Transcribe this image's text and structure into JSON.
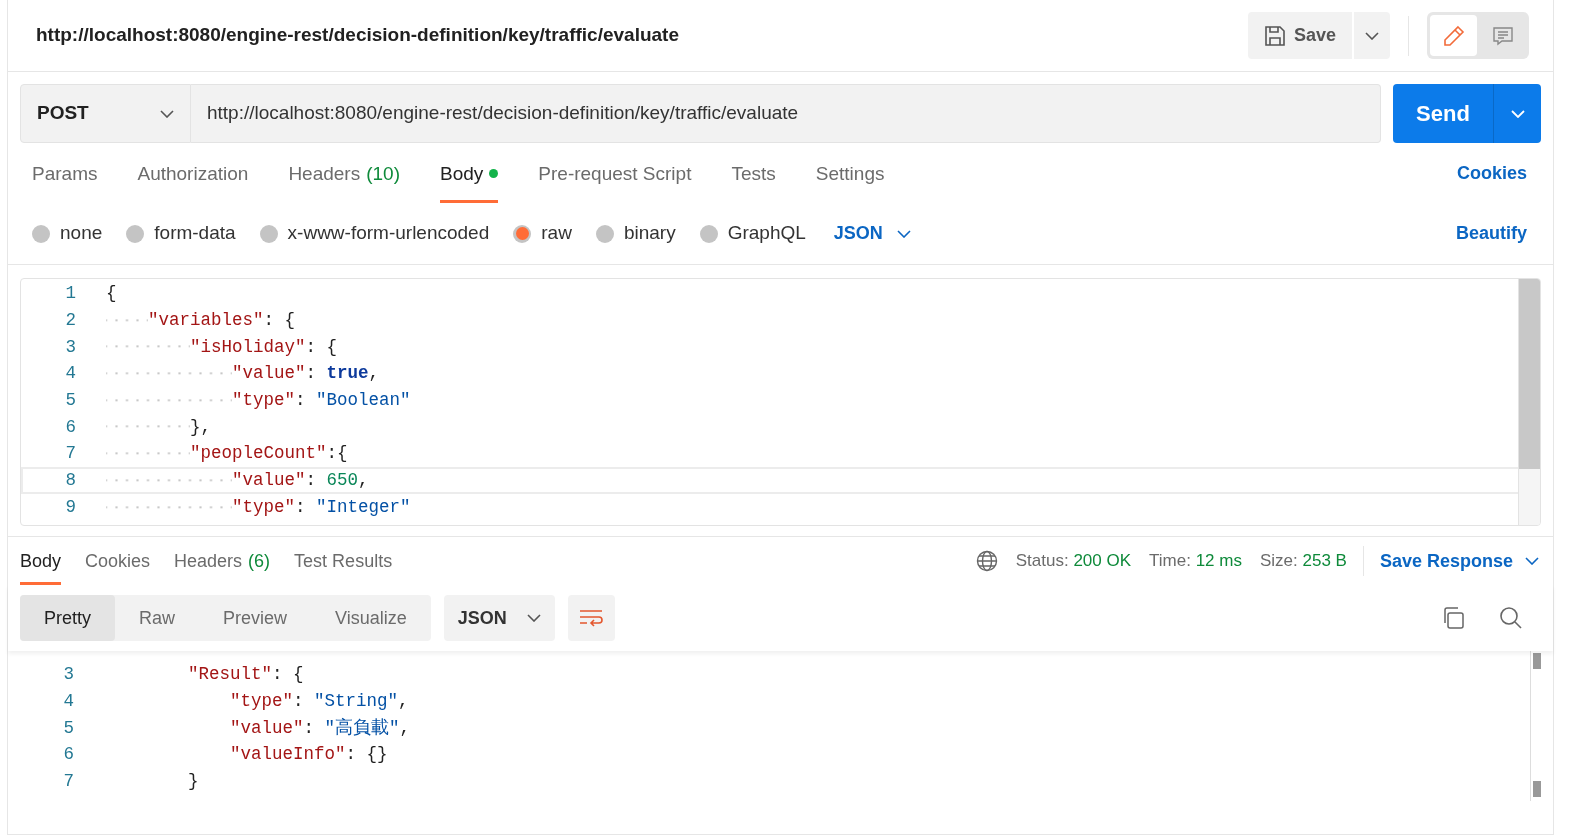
{
  "header": {
    "title": "http://localhost:8080/engine-rest/decision-definition/key/traffic/evaluate",
    "save_label": "Save",
    "modes": [
      {
        "kind": "edit",
        "selected": true
      },
      {
        "kind": "comment",
        "selected": false
      }
    ]
  },
  "request": {
    "method": "POST",
    "url": "http://localhost:8080/engine-rest/decision-definition/key/traffic/evaluate",
    "send_label": "Send"
  },
  "request_tabs": [
    {
      "label": "Params",
      "selected": false
    },
    {
      "label": "Authorization",
      "selected": false
    },
    {
      "label": "Headers",
      "count": "(10)",
      "selected": false
    },
    {
      "label": "Body",
      "dot": true,
      "selected": true
    },
    {
      "label": "Pre-request Script",
      "selected": false
    },
    {
      "label": "Tests",
      "selected": false
    },
    {
      "label": "Settings",
      "selected": false
    }
  ],
  "cookies_link": "Cookies",
  "body_types": [
    {
      "label": "none",
      "selected": false
    },
    {
      "label": "form-data",
      "selected": false
    },
    {
      "label": "x-www-form-urlencoded",
      "selected": false
    },
    {
      "label": "raw",
      "selected": true
    },
    {
      "label": "binary",
      "selected": false
    },
    {
      "label": "GraphQL",
      "selected": false
    }
  ],
  "format": "JSON",
  "beautify_link": "Beautify",
  "request_body": [
    {
      "number": "1",
      "current": false,
      "tokens": [
        {
          "kind": "punct",
          "text": "{"
        }
      ],
      "children": [
        {
          "number": "2",
          "current": false,
          "tokens": [
            {
              "kind": "key",
              "text": "\"variables\""
            },
            {
              "kind": "punct",
              "text": ": {"
            }
          ],
          "children": [
            {
              "number": "3",
              "current": false,
              "tokens": [
                {
                  "kind": "key",
                  "text": "\"isHoliday\""
                },
                {
                  "kind": "punct",
                  "text": ": {"
                }
              ],
              "children": [
                {
                  "number": "4",
                  "current": false,
                  "tokens": [
                    {
                      "kind": "key",
                      "text": "\"value\""
                    },
                    {
                      "kind": "punct",
                      "text": ": "
                    },
                    {
                      "kind": "bool",
                      "text": "true"
                    },
                    {
                      "kind": "punct",
                      "text": ","
                    }
                  ]
                },
                {
                  "number": "5",
                  "current": false,
                  "tokens": [
                    {
                      "kind": "key",
                      "text": "\"type\""
                    },
                    {
                      "kind": "punct",
                      "text": ": "
                    },
                    {
                      "kind": "string",
                      "text": "\"Boolean\""
                    }
                  ]
                }
              ]
            },
            {
              "number": "6",
              "current": false,
              "tokens": [
                {
                  "kind": "punct",
                  "text": "},"
                }
              ]
            },
            {
              "number": "7",
              "current": false,
              "tokens": [
                {
                  "kind": "key",
                  "text": "\"peopleCount\""
                },
                {
                  "kind": "punct",
                  "text": ":{"
                }
              ],
              "children": [
                {
                  "number": "8",
                  "current": true,
                  "tokens": [
                    {
                      "kind": "key",
                      "text": "\"value\""
                    },
                    {
                      "kind": "punct",
                      "text": ": "
                    },
                    {
                      "kind": "number",
                      "text": "650"
                    },
                    {
                      "kind": "punct",
                      "text": ","
                    }
                  ]
                },
                {
                  "number": "9",
                  "current": false,
                  "tokens": [
                    {
                      "kind": "key",
                      "text": "\"type\""
                    },
                    {
                      "kind": "punct",
                      "text": ": "
                    },
                    {
                      "kind": "string",
                      "text": "\"Integer\""
                    }
                  ]
                }
              ]
            }
          ]
        }
      ]
    }
  ],
  "response_tabs": [
    {
      "label": "Body",
      "selected": true
    },
    {
      "label": "Cookies",
      "selected": false
    },
    {
      "label": "Headers",
      "count": "(6)",
      "selected": false
    },
    {
      "label": "Test Results",
      "selected": false
    }
  ],
  "response_meta": [
    {
      "label": "Status:",
      "value": "200 OK"
    },
    {
      "label": "Time:",
      "value": "12 ms"
    },
    {
      "label": "Size:",
      "value": "253 B"
    }
  ],
  "save_response": "Save Response",
  "view_modes": [
    {
      "label": "Pretty",
      "selected": true
    },
    {
      "label": "Raw",
      "selected": false
    },
    {
      "label": "Preview",
      "selected": false
    },
    {
      "label": "Visualize",
      "selected": false
    }
  ],
  "response_format": "JSON",
  "response_body": [
    {
      "number": "3",
      "tokens": [
        {
          "kind": "key",
          "text": "\"Result\""
        },
        {
          "kind": "punct",
          "text": ": {"
        }
      ],
      "children": [
        {
          "number": "4",
          "tokens": [
            {
              "kind": "key",
              "text": "\"type\""
            },
            {
              "kind": "punct",
              "text": ": "
            },
            {
              "kind": "string",
              "text": "\"String\""
            },
            {
              "kind": "punct",
              "text": ","
            }
          ]
        },
        {
          "number": "5",
          "tokens": [
            {
              "kind": "key",
              "text": "\"value\""
            },
            {
              "kind": "punct",
              "text": ": "
            },
            {
              "kind": "string",
              "text": "\"高負載\""
            },
            {
              "kind": "punct",
              "text": ","
            }
          ]
        },
        {
          "number": "6",
          "tokens": [
            {
              "kind": "key",
              "text": "\"valueInfo\""
            },
            {
              "kind": "punct",
              "text": ": {}"
            }
          ]
        }
      ]
    },
    {
      "number": "7",
      "tokens": [
        {
          "kind": "punct",
          "text": "}"
        }
      ]
    }
  ]
}
